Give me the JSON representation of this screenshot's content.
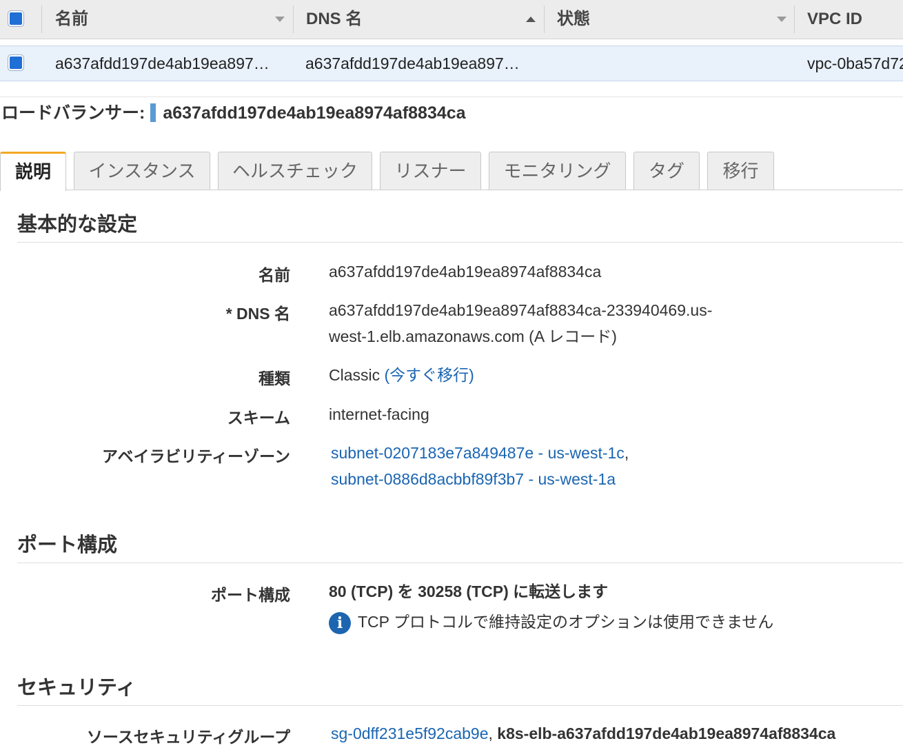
{
  "table": {
    "columns": [
      {
        "label": "名前",
        "sort": "down"
      },
      {
        "label": "DNS 名",
        "sort": "up"
      },
      {
        "label": "状態",
        "sort": "down"
      },
      {
        "label": "VPC ID",
        "sort": ""
      }
    ],
    "row": {
      "name": "a637afdd197de4ab19ea897…",
      "dns": "a637afdd197de4ab19ea897…",
      "state": "",
      "vpc": "vpc-0ba57d72"
    }
  },
  "lb_header": {
    "label": "ロードバランサー:",
    "name": "a637afdd197de4ab19ea8974af8834ca"
  },
  "tabs": [
    {
      "label": "説明",
      "active": true
    },
    {
      "label": "インスタンス",
      "active": false
    },
    {
      "label": "ヘルスチェック",
      "active": false
    },
    {
      "label": "リスナー",
      "active": false
    },
    {
      "label": "モニタリング",
      "active": false
    },
    {
      "label": "タグ",
      "active": false
    },
    {
      "label": "移行",
      "active": false
    }
  ],
  "basic": {
    "title": "基本的な設定",
    "name_label": "名前",
    "name_value": "a637afdd197de4ab19ea8974af8834ca",
    "dns_label": "* DNS 名",
    "dns_value_line1": "a637afdd197de4ab19ea8974af8834ca-233940469.us-",
    "dns_value_line2": "west-1.elb.amazonaws.com (A レコード)",
    "type_label": "種類",
    "type_value": "Classic",
    "type_link": "(今すぐ移行)",
    "scheme_label": "スキーム",
    "scheme_value": "internet-facing",
    "az_label": "アベイラビリティーゾーン",
    "az_links": [
      "subnet-0207183e7a849487e - us-west-1c",
      "subnet-0886d8acbbf89f3b7 - us-west-1a"
    ],
    "az_separator": ","
  },
  "ports": {
    "title": "ポート構成",
    "label": "ポート構成",
    "value": "80 (TCP) を 30258 (TCP) に転送します",
    "info_icon": "info-icon",
    "note": "TCP プロトコルで維持設定のオプションは使用できません"
  },
  "security": {
    "title": "セキュリティ",
    "sg_label": "ソースセキュリティグループ",
    "sg_link": "sg-0dff231e5f92cab9e",
    "sg_separator": ",",
    "sg_name": "k8s-elb-a637afdd197de4ab19ea8974af8834ca"
  },
  "colors": {
    "checkbox": "#1f6fd6",
    "link": "#1a65b2",
    "active_tab_accent": "#f4a724",
    "selected_row": "#e9f1fb"
  }
}
